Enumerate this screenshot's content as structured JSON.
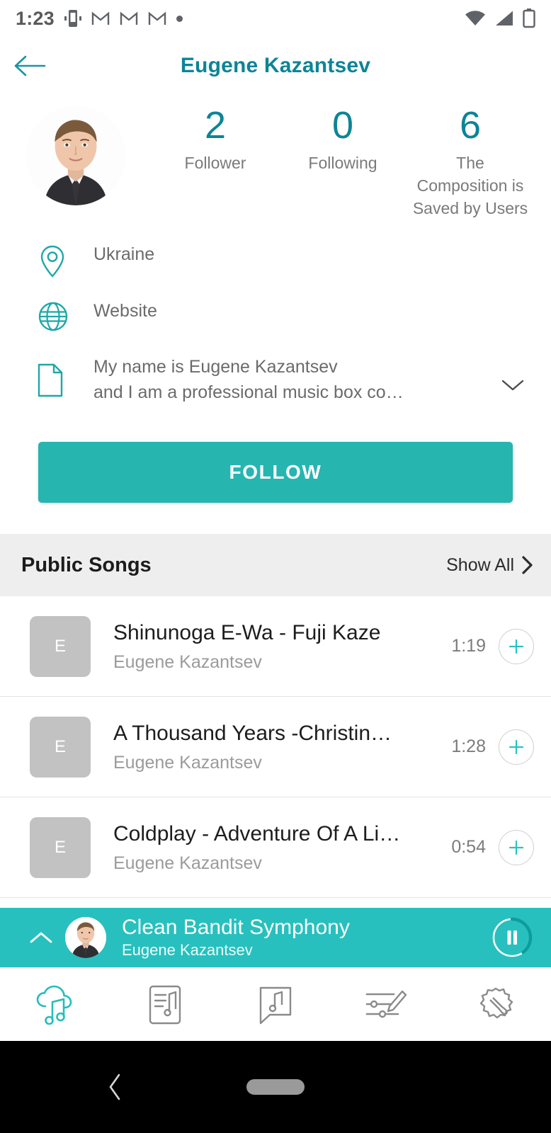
{
  "status_bar": {
    "time": "1:23",
    "icons": [
      "vibrate-icon",
      "gmail-icon",
      "gmail-icon",
      "gmail-icon",
      "dot-icon"
    ],
    "right_icons": [
      "wifi-icon",
      "cellular-signal-icon",
      "battery-icon"
    ]
  },
  "app_bar": {
    "title": "Eugene Kazantsev",
    "back_icon": "arrow-left-icon"
  },
  "profile": {
    "avatar_alt": "Eugene Kazantsev",
    "stats": [
      {
        "value": "2",
        "label": "Follower"
      },
      {
        "value": "0",
        "label": "Following"
      },
      {
        "value": "6",
        "label": "The Composition is Saved by Users"
      }
    ],
    "info": [
      {
        "icon": "location-pin-icon",
        "text": "Ukraine"
      },
      {
        "icon": "globe-icon",
        "text": "Website"
      }
    ],
    "bio": {
      "icon": "document-icon",
      "text": "My name is Eugene Kazantsev\nand I am a professional music box co…",
      "expand_icon": "chevron-down-icon"
    },
    "follow_label": "FOLLOW"
  },
  "songs_section": {
    "title": "Public Songs",
    "show_all_label": "Show All",
    "show_all_icon": "chevron-right-icon",
    "items": [
      {
        "thumb_letter": "E",
        "title": "Shinunoga E-Wa - Fuji Kaze",
        "artist": "Eugene Kazantsev",
        "duration": "1:19",
        "action_icon": "plus-icon"
      },
      {
        "thumb_letter": "E",
        "title": "A Thousand Years -Christin…",
        "artist": "Eugene Kazantsev",
        "duration": "1:28",
        "action_icon": "plus-icon"
      },
      {
        "thumb_letter": "E",
        "title": "Coldplay - Adventure Of A Li…",
        "artist": "Eugene Kazantsev",
        "duration": "0:54",
        "action_icon": "plus-icon"
      }
    ]
  },
  "player": {
    "expand_icon": "chevron-up-icon",
    "title": "Clean Bandit Symphony",
    "artist": "Eugene Kazantsev",
    "action_icon": "pause-icon",
    "progress_percent": 40
  },
  "bottom_nav": [
    {
      "icon": "cloud-music-icon",
      "active": true
    },
    {
      "icon": "music-library-icon",
      "active": false
    },
    {
      "icon": "music-message-icon",
      "active": false
    },
    {
      "icon": "equalizer-edit-icon",
      "active": false
    },
    {
      "icon": "settings-gear-icon",
      "active": false
    }
  ],
  "android_nav": {
    "back_icon": "system-back-icon",
    "home_icon": "system-home-pill"
  },
  "colors": {
    "accent_dark": "#0d8497",
    "accent": "#27b5b0",
    "player_bg": "#27c0be",
    "section_bg": "#eeeeee",
    "thumb_bg": "#c2c2c2"
  }
}
